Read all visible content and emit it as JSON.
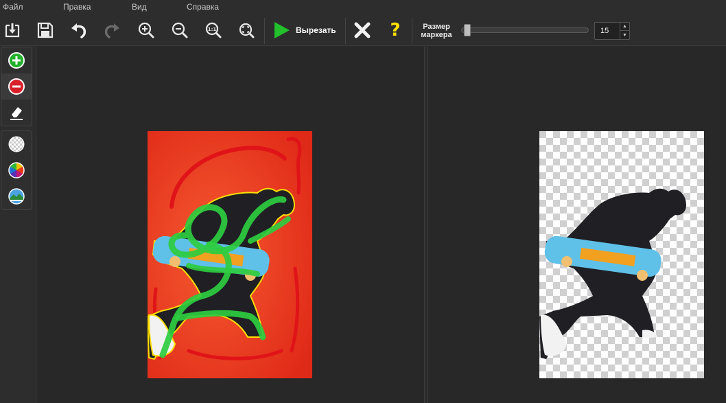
{
  "menu": {
    "file": "Файл",
    "edit": "Правка",
    "view": "Вид",
    "help": "Справка"
  },
  "toolbar": {
    "cut_label": "Вырезать",
    "marker_label_line1": "Размер",
    "marker_label_line2": "маркера",
    "marker_size": "15",
    "marker_size_fraction": 0.02,
    "help_glyph": "?"
  },
  "icons": {
    "open": "open-file-icon",
    "save": "save-icon",
    "undo": "undo-icon",
    "redo": "redo-icon",
    "zoom_in": "zoom-in-icon",
    "zoom_out": "zoom-out-icon",
    "zoom_actual": "zoom-actual-size-icon",
    "fit": "fit-to-window-icon",
    "cut": "play-icon",
    "cancel": "close-icon",
    "help": "help-icon",
    "add": "plus-circle-icon",
    "remove": "minus-circle-icon",
    "erase": "eraser-icon",
    "background_transparent": "transparent-background-icon",
    "background_color": "color-wheel-icon",
    "background_image": "landscape-icon"
  },
  "colors": {
    "accent_green": "#2ecc40",
    "remove_red": "#e0202a",
    "help_yellow": "#ffe000",
    "source_background": "#f03a1e"
  }
}
